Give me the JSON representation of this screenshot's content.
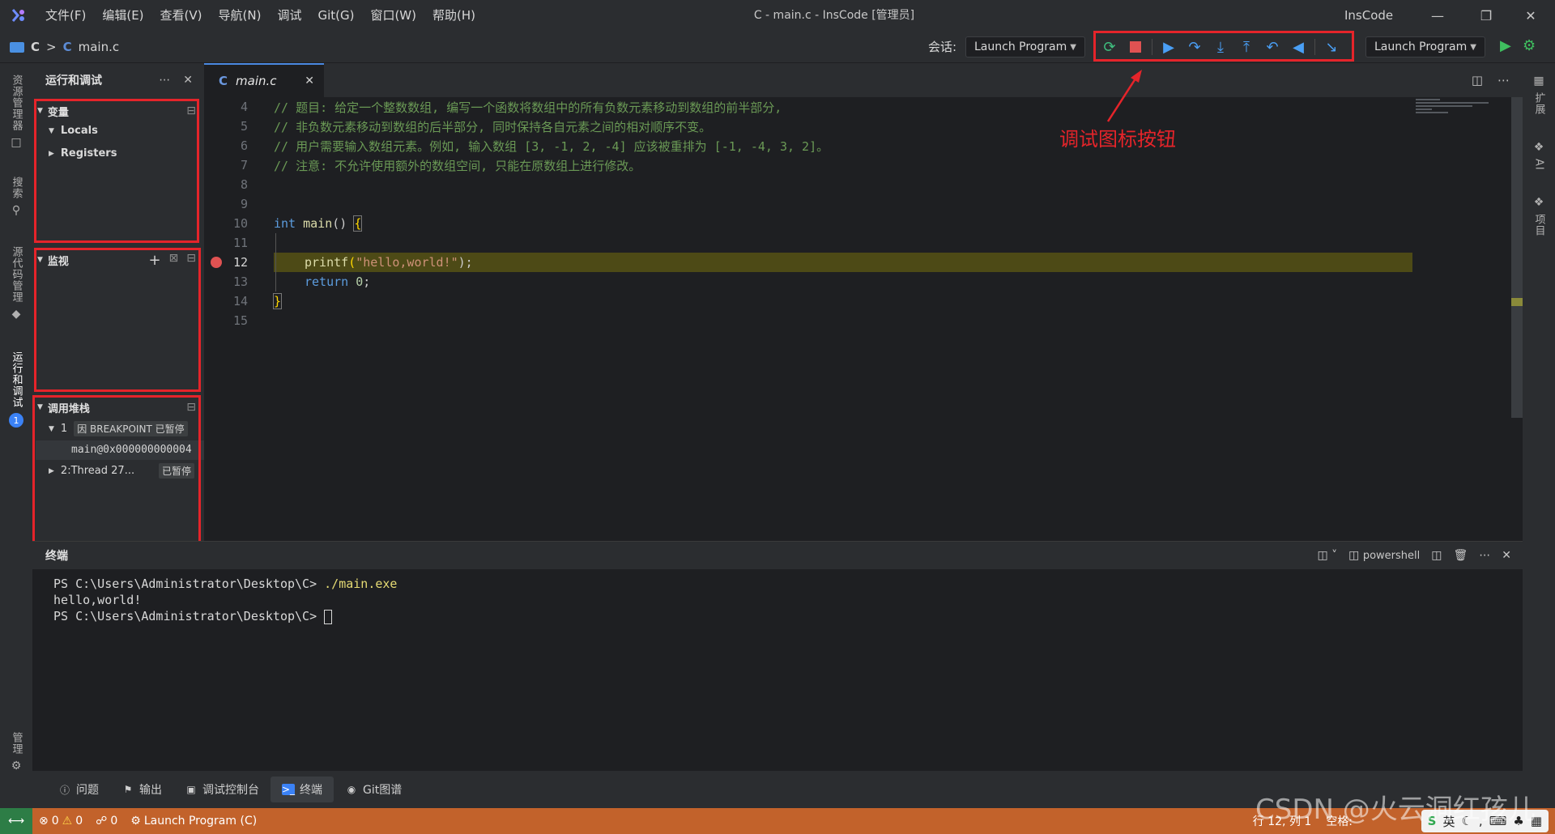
{
  "titlebar": {
    "menus": [
      "文件(F)",
      "编辑(E)",
      "查看(V)",
      "导航(N)",
      "调试",
      "Git(G)",
      "窗口(W)",
      "帮助(H)"
    ],
    "window_title": "C - main.c - InsCode [管理员]",
    "app_name": "InsCode"
  },
  "navbar": {
    "crumb_folder": "C",
    "crumb_file_icon": "C",
    "crumb_file": "main.c",
    "session_label": "会话:",
    "session_value": "Launch Program",
    "launch_config": "Launch Program"
  },
  "activity_left": {
    "explorer": "资源管理器",
    "search": "搜索",
    "scm": "源代码管理",
    "run_debug": "运行和调试",
    "manage": "管理"
  },
  "activity_right": {
    "extensions": "扩展",
    "ai": "AI",
    "project": "项目"
  },
  "debug_panel": {
    "title": "运行和调试",
    "variables": {
      "title": "变量",
      "items": [
        "Locals",
        "Registers"
      ]
    },
    "watch": {
      "title": "监视"
    },
    "callstack": {
      "title": "调用堆栈",
      "thread1_id": "1",
      "thread1_badge": "因 BREAKPOINT 已暂停",
      "frame": "main@0x000000000004",
      "thread2": "2:Thread 27...",
      "thread2_badge": "已暂停"
    }
  },
  "editor": {
    "tab_icon": "C",
    "tab_label": "main.c",
    "lines": [
      {
        "no": "4",
        "code": "// 题目: 给定一个整数数组, 编写一个函数将数组中的所有负数元素移动到数组的前半部分,"
      },
      {
        "no": "5",
        "code": "// 非负数元素移动到数组的后半部分, 同时保持各自元素之间的相对顺序不变。"
      },
      {
        "no": "6",
        "code": "// 用户需要输入数组元素。例如, 输入数组 [3, -1, 2, -4] 应该被重排为 [-1, -4, 3, 2]。"
      },
      {
        "no": "7",
        "code": "// 注意: 不允许使用额外的数组空间, 只能在原数组上进行修改。"
      },
      {
        "no": "8",
        "code": ""
      },
      {
        "no": "9",
        "code": ""
      },
      {
        "no": "10",
        "code": ""
      },
      {
        "no": "11",
        "code": ""
      },
      {
        "no": "12",
        "code": ""
      },
      {
        "no": "13",
        "code": ""
      },
      {
        "no": "14",
        "code": ""
      },
      {
        "no": "15",
        "code": ""
      }
    ],
    "line10": {
      "kw": "int",
      "fn": "main",
      "rest": "() ",
      "brace": "{"
    },
    "line12": {
      "fn": "printf",
      "open": "(",
      "str": "\"hello,world!\"",
      "close": ");"
    },
    "line13": {
      "kw": "return",
      "num": "0",
      "end": ";"
    },
    "line14": {
      "brace": "}"
    }
  },
  "annotation": {
    "text": "调试图标按钮"
  },
  "terminal": {
    "title": "终端",
    "shell": "powershell",
    "prompt1": "PS C:\\Users\\Administrator\\Desktop\\C> ",
    "cmd1": "./main.exe",
    "output": "hello,world!",
    "prompt2": "PS C:\\Users\\Administrator\\Desktop\\C> "
  },
  "bottom_tabs": [
    "问题",
    "输出",
    "调试控制台",
    "终端",
    "Git图谱"
  ],
  "statusbar": {
    "errors": "0",
    "warnings": "0",
    "ports": "0",
    "launch": "Launch Program (C)",
    "position": "行 12, 列 1",
    "spaces": "空格:",
    "ime_lang": "英"
  },
  "watermark": "CSDN @火云洞红孩儿",
  "colors": {
    "accent_red": "#e5242a",
    "status_bg": "#c2622b",
    "debug_line": "#4d4a16",
    "breakpoint": "#e05252"
  }
}
